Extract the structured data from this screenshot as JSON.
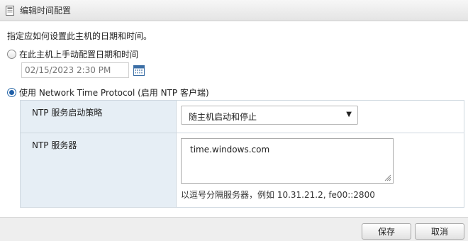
{
  "dialog": {
    "title": "编辑时间配置",
    "icon": "settings-dialog-icon"
  },
  "instructions": "指定应如何设置此主机的日期和时间。",
  "manual": {
    "label": "在此主机上手动配置日期和时间",
    "selected": false,
    "date_time_placeholder": "02/15/2023 2:30 PM",
    "calendar_icon": "calendar-icon"
  },
  "ntp": {
    "label": "使用 Network Time Protocol (启用 NTP 客户端)",
    "selected": true,
    "startup_policy": {
      "label": "NTP 服务启动策略",
      "value": "随主机启动和停止"
    },
    "servers": {
      "label": "NTP 服务器",
      "value": "time.windows.com",
      "hint": "以逗号分隔服务器，例如 10.31.21.2, fe00::2800"
    }
  },
  "buttons": {
    "save": "保存",
    "cancel": "取消"
  },
  "colors": {
    "accent": "#1f5fa8",
    "label_cell_bg": "#e6eef5"
  }
}
